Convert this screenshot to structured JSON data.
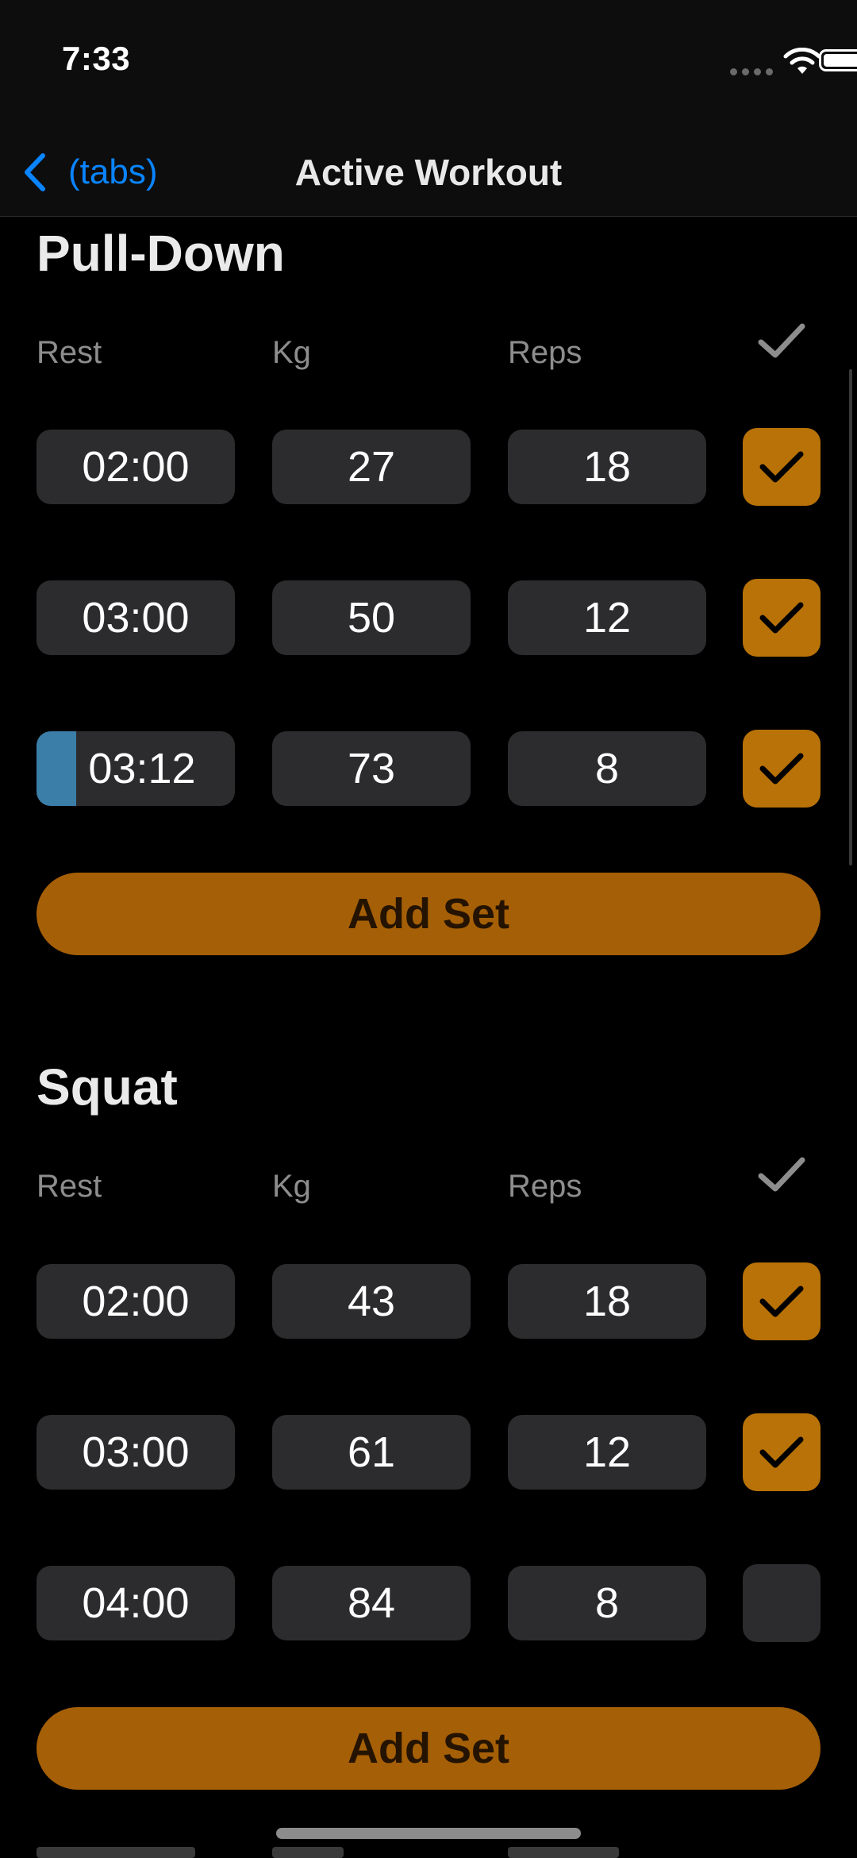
{
  "status_bar": {
    "time": "7:33"
  },
  "nav": {
    "back_label": "(tabs)",
    "title": "Active Workout"
  },
  "columns": {
    "rest": "Rest",
    "kg": "Kg",
    "reps": "Reps"
  },
  "exercises": [
    {
      "name": "Pull-Down",
      "sets": [
        {
          "rest": "02:00",
          "kg": "27",
          "reps": "18",
          "done": true
        },
        {
          "rest": "03:00",
          "kg": "50",
          "reps": "12",
          "done": true
        },
        {
          "rest": "03:12",
          "kg": "73",
          "reps": "8",
          "done": true,
          "rest_timer_progress": 0.2
        }
      ],
      "add_set_label": "Add Set"
    },
    {
      "name": "Squat",
      "sets": [
        {
          "rest": "02:00",
          "kg": "43",
          "reps": "18",
          "done": true
        },
        {
          "rest": "03:00",
          "kg": "61",
          "reps": "12",
          "done": true
        },
        {
          "rest": "04:00",
          "kg": "84",
          "reps": "8",
          "done": false
        }
      ],
      "add_set_label": "Add Set"
    }
  ],
  "colors": {
    "accent": "#a55f06",
    "check_on": "#b87208",
    "timer_progress": "#3b7ea8",
    "link": "#0a84ff"
  }
}
